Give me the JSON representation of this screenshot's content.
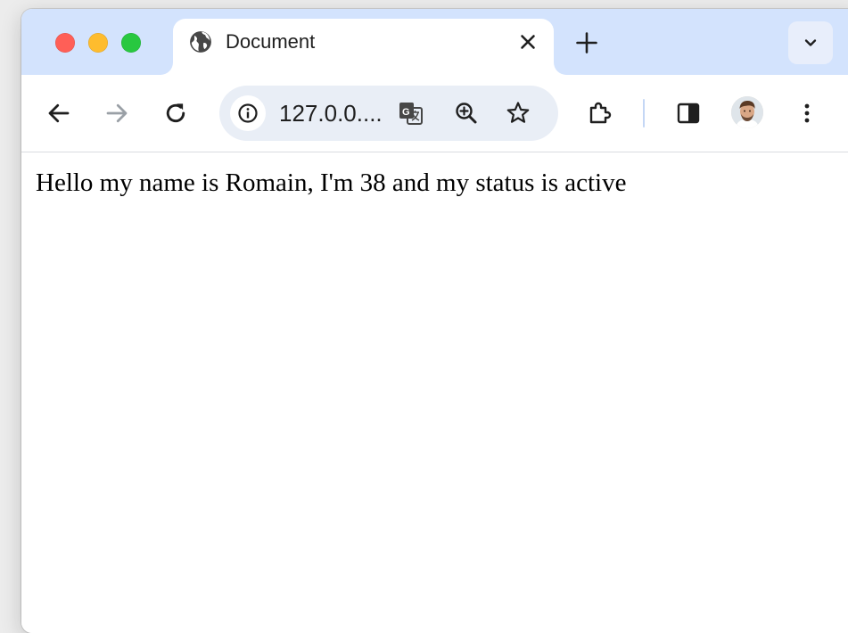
{
  "window": {
    "traffic_lights": [
      "close",
      "minimize",
      "zoom"
    ],
    "colors": {
      "close": "#ff5f57",
      "minimize": "#febc2e",
      "zoom": "#28c840",
      "tabstrip": "#d3e3fd",
      "omnibox": "#e9eef6"
    }
  },
  "tab": {
    "title": "Document",
    "icon": "globe-icon"
  },
  "toolbar": {
    "url": "127.0.0....",
    "icons": [
      "back-icon",
      "forward-icon",
      "reload-icon",
      "site-info-icon",
      "translate-icon",
      "zoom-icon",
      "bookmark-star-icon",
      "extensions-icon",
      "side-panel-icon",
      "profile-avatar",
      "more-menu-icon"
    ]
  },
  "page": {
    "text": "Hello my name is Romain, I'm 38 and my status is active"
  }
}
